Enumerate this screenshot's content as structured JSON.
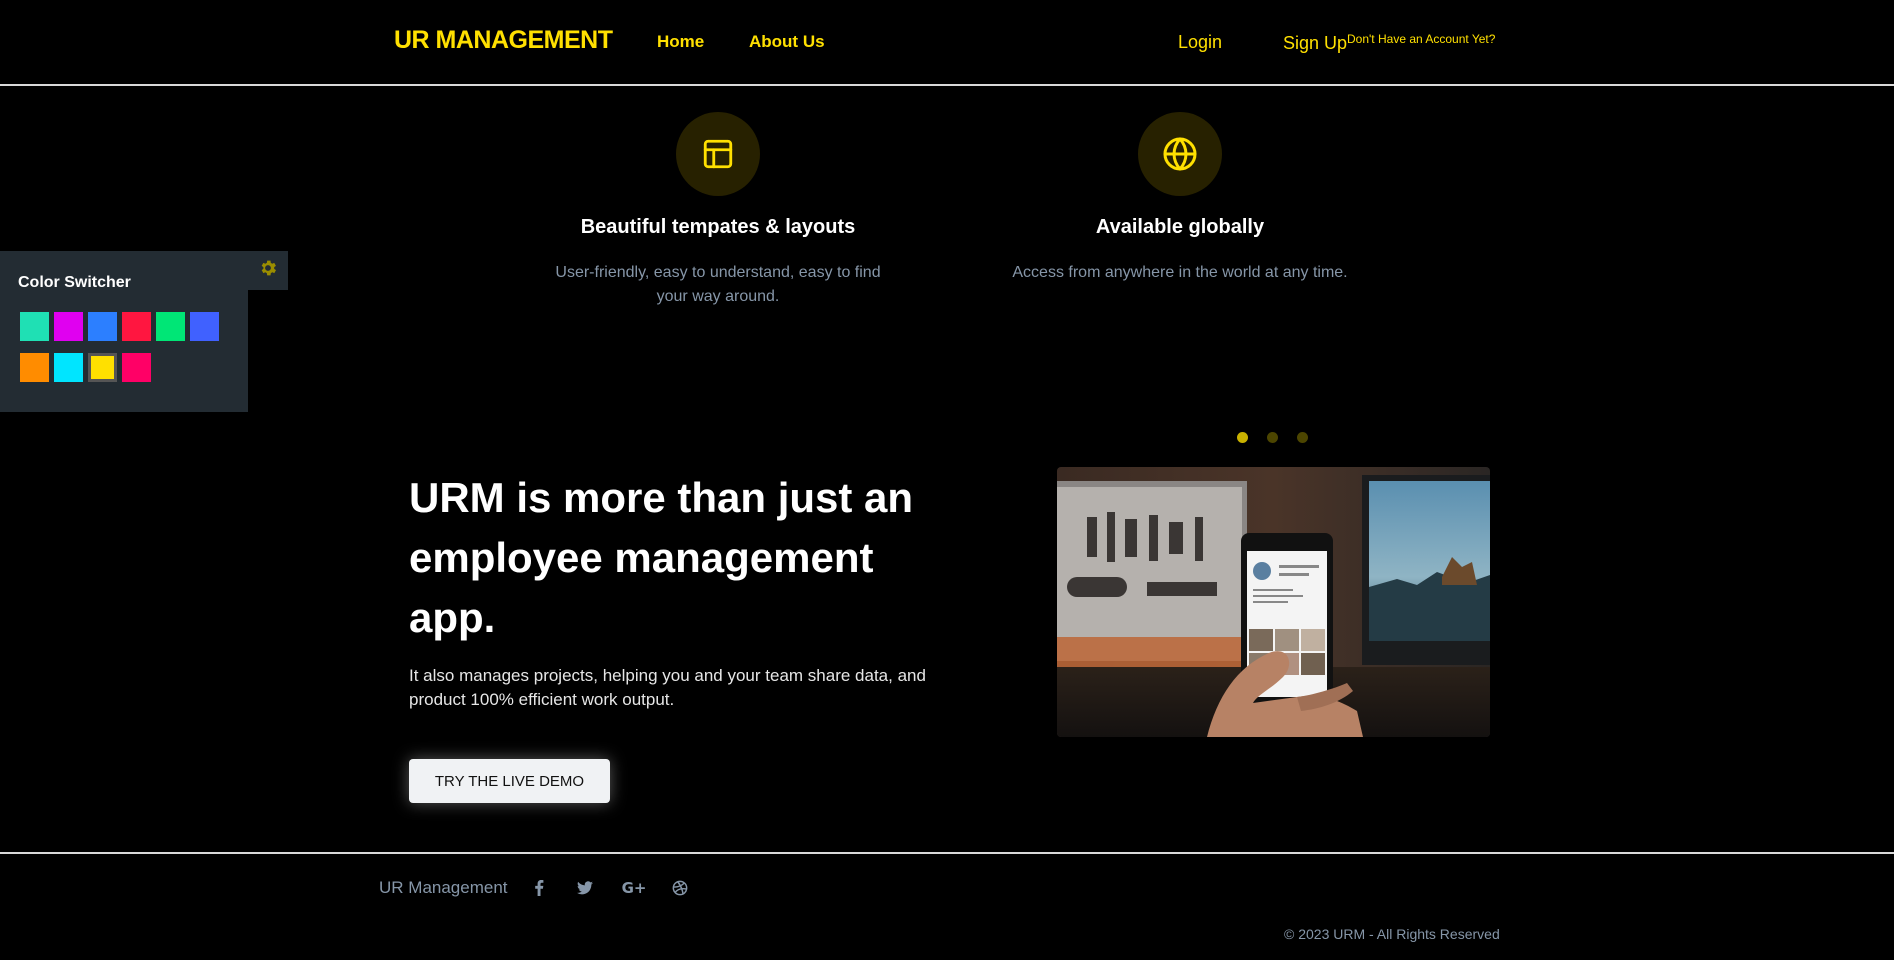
{
  "nav": {
    "brand": "UR MANAGEMENT",
    "home": "Home",
    "about": "About Us",
    "login": "Login",
    "signup": "Sign Up",
    "signup_hint": "Don't Have an Account Yet?"
  },
  "features": [
    {
      "icon": "layout-icon",
      "title": "Beautiful tempates & layouts",
      "text": "User-friendly, easy to understand, easy to find your way around."
    },
    {
      "icon": "globe-icon",
      "title": "Available globally",
      "text": "Access from anywhere in the world at any time."
    }
  ],
  "color_switcher": {
    "title": "Color Switcher",
    "icon": "gear-icon",
    "swatches": [
      "#1fe0b4",
      "#e000f0",
      "#2c7fff",
      "#ff1640",
      "#00e676",
      "#4061ff",
      "#ff8c00",
      "#00e5ff",
      "#ffe000",
      "#ff0066"
    ],
    "active": "#ffe000"
  },
  "hero": {
    "title": "URM is more than just an employee management app.",
    "text": "It also manages projects, helping you and your team share data, and product 100% efficient work output.",
    "cta": "TRY THE LIVE DEMO",
    "carousel_slides": 3,
    "carousel_active": 1
  },
  "footer": {
    "brand": "UR Management",
    "social": [
      "facebook-icon",
      "twitter-icon",
      "google-plus-icon",
      "dribbble-icon"
    ],
    "copyright": "© 2023 URM - All Rights Reserved"
  },
  "colors": {
    "accent": "#ffe000",
    "muted_text": "#8696a8",
    "panel": "#232c33"
  }
}
